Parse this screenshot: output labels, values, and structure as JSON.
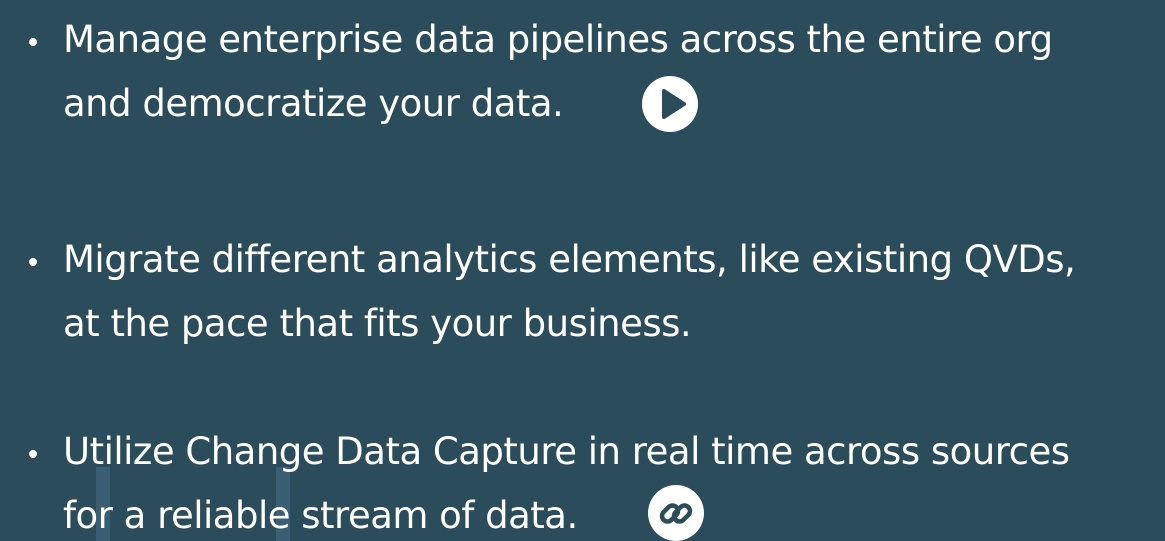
{
  "bullets": [
    {
      "line1": "Manage enterprise data pipelines across the entire org",
      "line2": "and democratize your data.",
      "icon": "play-icon"
    },
    {
      "line1": "Migrate different analytics elements, like existing QVDs,",
      "line2": "at the pace that fits your business."
    },
    {
      "line1": "Utilize Change Data Capture in real time across sources",
      "line2": "for a reliable stream of data.",
      "icon": "link-icon"
    }
  ],
  "colors": {
    "background": "#2b4c5a",
    "text": "#ffffff",
    "stripe": "#3a5f73"
  }
}
